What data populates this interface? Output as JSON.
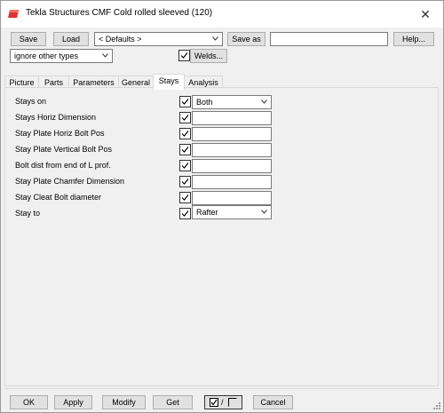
{
  "window": {
    "title": "Tekla Structures  CMF Cold rolled sleeved (120)",
    "close_glyph": "✕",
    "accent_color": "#e03030"
  },
  "toolbar": {
    "save_label": "Save",
    "load_label": "Load",
    "attributes_value": "< Defaults >",
    "save_as_label": "Save as",
    "save_as_value": "",
    "help_label": "Help...",
    "filter_value": "ignore other types",
    "welds_label": "Welds...",
    "welds_checked": true
  },
  "tabs": [
    {
      "label": "Picture",
      "active": false
    },
    {
      "label": "Parts",
      "active": false
    },
    {
      "label": "Parameters",
      "active": false
    },
    {
      "label": "General",
      "active": false
    },
    {
      "label": "Stays",
      "active": true
    },
    {
      "label": "Analysis",
      "active": false
    }
  ],
  "stays": {
    "rows": [
      {
        "label": "Stays on",
        "checked": true,
        "type": "select",
        "value": "Both"
      },
      {
        "label": "Stays Horiz Dimension",
        "checked": true,
        "type": "text",
        "value": ""
      },
      {
        "label": "Stay Plate Horiz Bolt Pos",
        "checked": true,
        "type": "text",
        "value": ""
      },
      {
        "label": "Stay Plate Vertical Bolt Pos",
        "checked": true,
        "type": "text",
        "value": ""
      },
      {
        "label": "Bolt dist from end of L prof.",
        "checked": true,
        "type": "text",
        "value": ""
      },
      {
        "label": "Stay Plate Chamfer Dimension",
        "checked": true,
        "type": "text",
        "value": ""
      },
      {
        "label": "Stay Cleat Bolt diameter",
        "checked": true,
        "type": "text",
        "value": ""
      },
      {
        "label": "Stay to",
        "checked": true,
        "type": "select",
        "value": "Rafter"
      }
    ]
  },
  "footer": {
    "ok_label": "OK",
    "apply_label": "Apply",
    "modify_label": "Modify",
    "get_label": "Get",
    "toggle_separator": "/",
    "cancel_label": "Cancel"
  }
}
